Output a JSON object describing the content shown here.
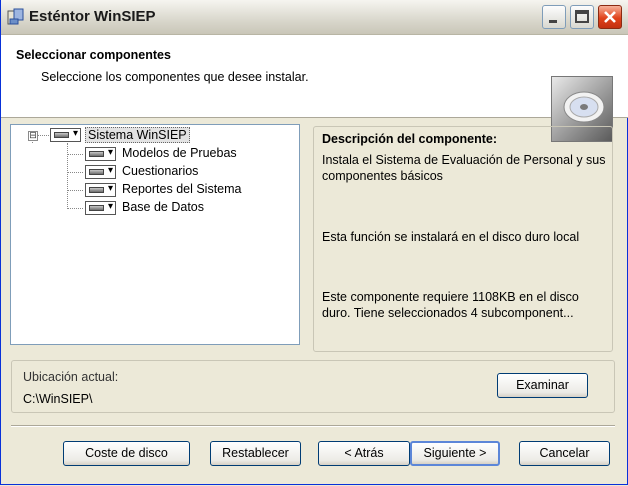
{
  "window": {
    "title": "Esténtor WinSIEP"
  },
  "icons": {
    "app": "installer-icon",
    "minimize": "minimize-icon",
    "maximize": "maximize-icon",
    "close": "close-icon",
    "header": "cd-disc-icon",
    "drive": "hard-drive-icon",
    "expander": "minus-expander-icon"
  },
  "header": {
    "title": "Seleccionar componentes",
    "subtitle": "Seleccione los componentes que desee instalar."
  },
  "tree": {
    "root": {
      "label": "Sistema WinSIEP",
      "expander": "⊟"
    },
    "children": [
      {
        "label": "Modelos de Pruebas"
      },
      {
        "label": "Cuestionarios"
      },
      {
        "label": "Reportes del Sistema"
      },
      {
        "label": "Base de Datos"
      }
    ]
  },
  "description": {
    "title": "Descripción del componente:",
    "text": "Instala el Sistema de Evaluación de Personal y sus componentes básicos",
    "install_note": "Esta función se instalará en el disco duro local",
    "space_note": "Este componente requiere 1108KB en el disco duro. Tiene seleccionados 4 subcomponent..."
  },
  "location": {
    "label": "Ubicación actual:",
    "path": "C:\\WinSIEP\\",
    "browse_label": "Examinar"
  },
  "buttons": {
    "disk_cost": "Coste de disco",
    "reset": "Restablecer",
    "back": "< Atrás",
    "next": "Siguiente >",
    "cancel": "Cancelar"
  }
}
